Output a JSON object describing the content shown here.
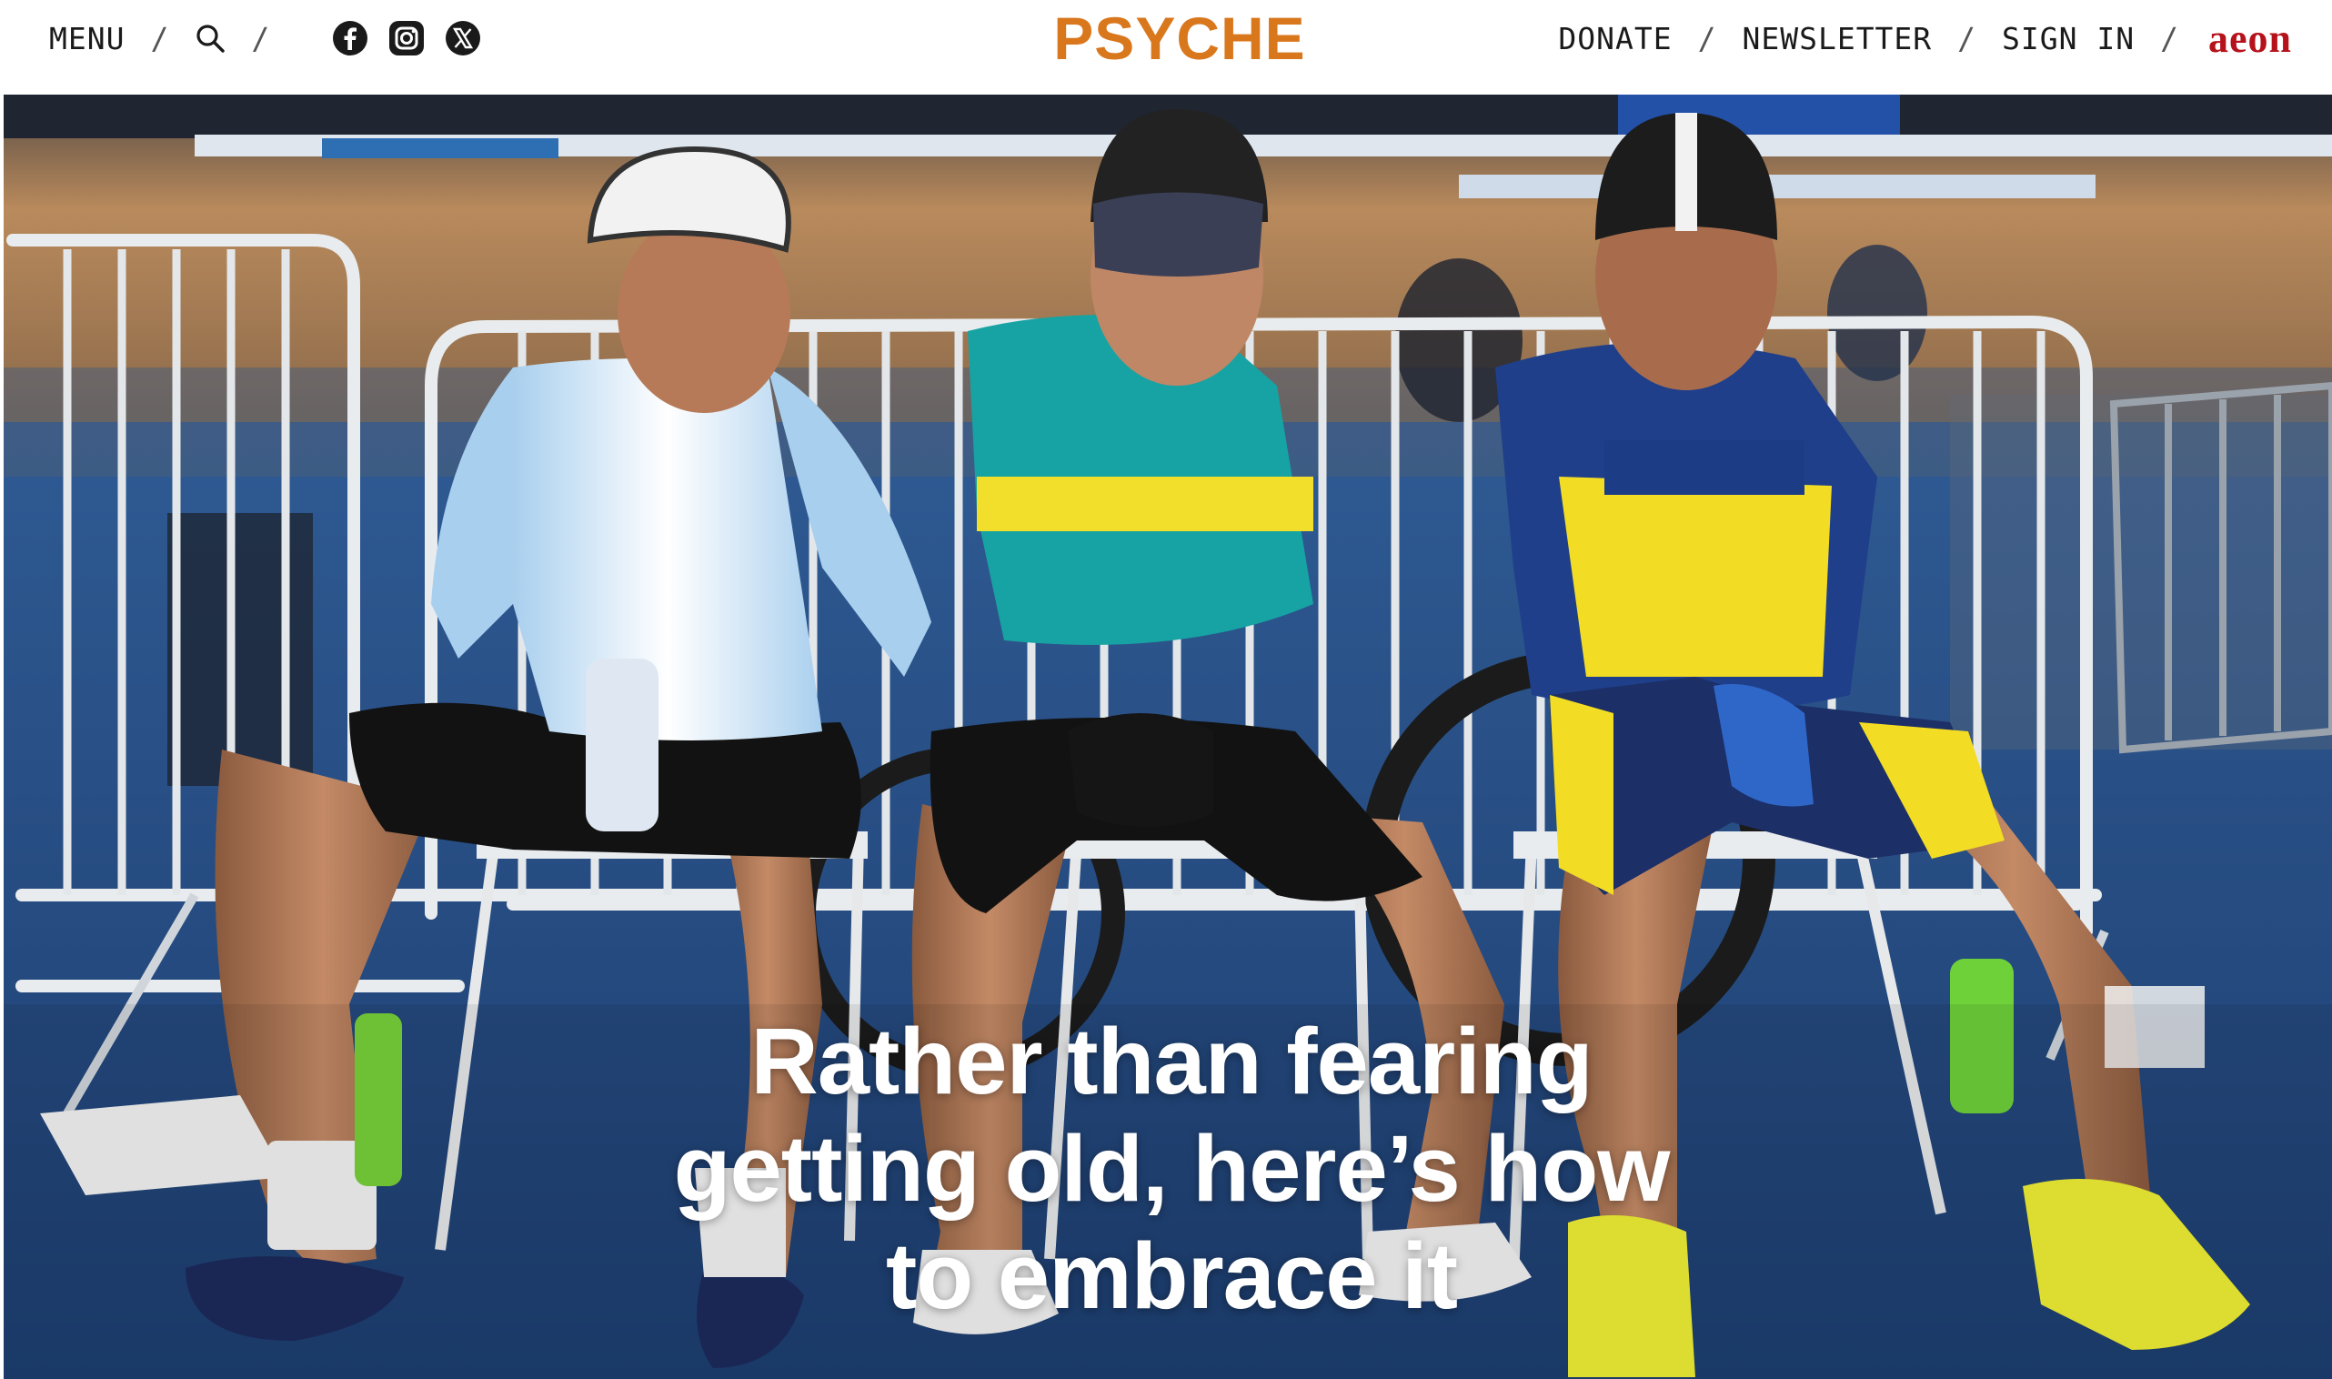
{
  "header": {
    "menu_label": "MENU",
    "separator": "/",
    "search_icon": "search-icon",
    "social_icons": [
      "facebook-icon",
      "instagram-icon",
      "x-icon"
    ],
    "logo_text": "PSYCHE",
    "donate_label": "DONATE",
    "newsletter_label": "NEWSLETTER",
    "sign_in_label": "SIGN IN",
    "aeon_logo_text": "aeon"
  },
  "hero": {
    "headline": "Rather than fearing getting old, here’s how to embrace it"
  },
  "colors": {
    "brand_orange": "#d9771d",
    "aeon_red": "#b5121b",
    "text_dark": "#1a1a1a"
  }
}
